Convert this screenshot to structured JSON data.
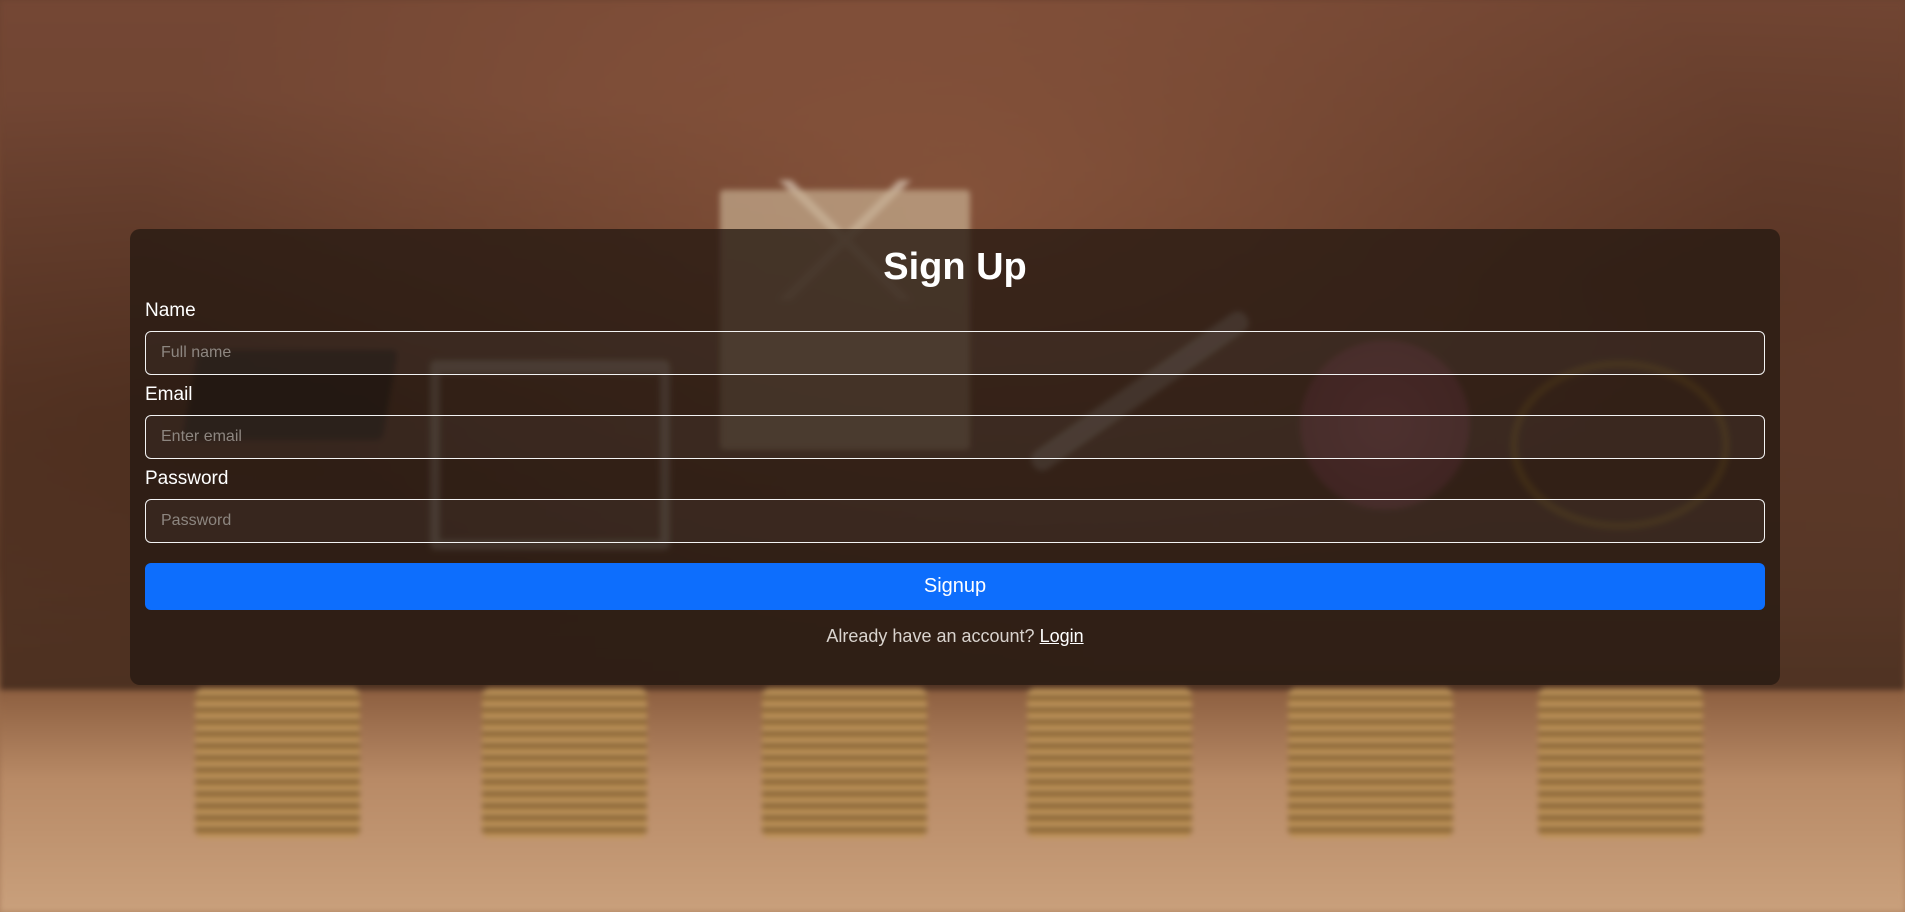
{
  "form": {
    "title": "Sign Up",
    "name_label": "Name",
    "name_placeholder": "Full name",
    "name_value": "",
    "email_label": "Email",
    "email_placeholder": "Enter email",
    "email_value": "",
    "password_label": "Password",
    "password_placeholder": "Password",
    "password_value": "",
    "submit_label": "Signup",
    "footer_prompt": "Already have an account?",
    "login_link": "Login"
  },
  "colors": {
    "primary_button": "#0d6efd",
    "card_overlay": "#261a12"
  },
  "background": {
    "icons": [
      "graduation-cap-icon",
      "shopping-cart-icon",
      "house-icon",
      "airplane-icon",
      "piggy-bank-icon",
      "heart-icon"
    ]
  }
}
